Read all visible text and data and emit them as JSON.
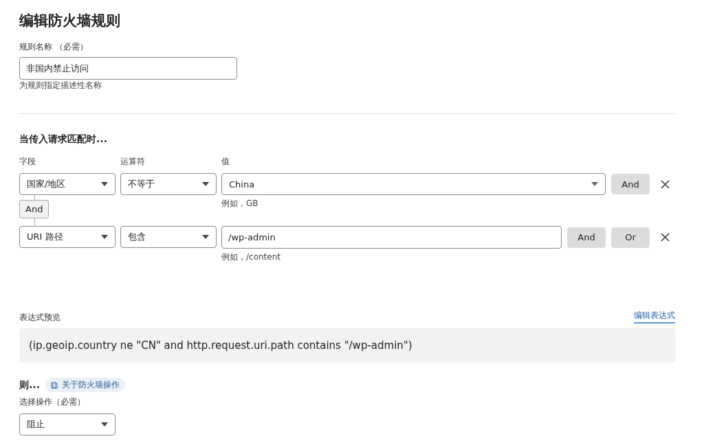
{
  "title": "编辑防火墙规则",
  "rule_name": {
    "label": "规则名称 （必需）",
    "value": "非国内禁止访问",
    "hint": "为规则指定描述性名称"
  },
  "conditions_heading": "当传入请求匹配时...",
  "columns": [
    "字段",
    "运算符",
    "值"
  ],
  "conditions": [
    {
      "field": "国家/地区",
      "operator": "不等于",
      "kind": "select",
      "value": "China",
      "hint": "例如，GB",
      "buttons": [
        "And"
      ]
    },
    {
      "field": "URI 路径",
      "operator": "包含",
      "kind": "input",
      "value": "/wp-admin",
      "hint": "例如，/content",
      "buttons": [
        "And",
        "Or"
      ]
    }
  ],
  "connector": "And",
  "expression": {
    "label": "表达式预览",
    "edit_link": "编辑表达式",
    "text": "(ip.geoip.country ne \"CN\" and http.request.uri.path contains \"/wp-admin\")"
  },
  "action": {
    "heading": "则...",
    "help_link": "关于防火墙操作",
    "label": "选择操作（必需）",
    "value": "阻止"
  }
}
